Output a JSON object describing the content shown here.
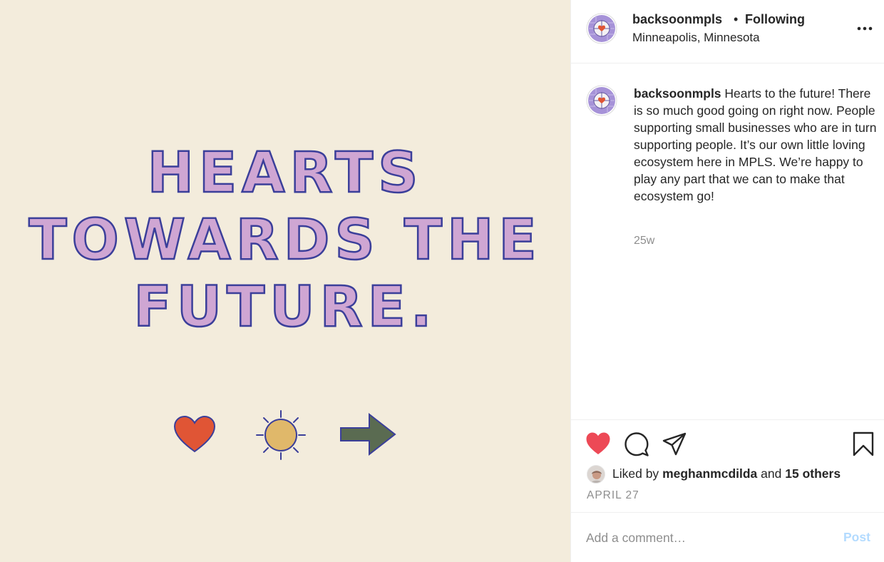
{
  "image": {
    "background_color": "#f3ecdc",
    "headline_lines": [
      "HEARTS",
      "TOWARDS THE",
      "FUTURE."
    ],
    "headline_fill": "#cfa6d3",
    "headline_outline": "#3b3f9a",
    "icons": [
      "heart-icon",
      "sun-icon",
      "arrow-right-icon"
    ]
  },
  "header": {
    "username": "backsoonmpls",
    "separator": "•",
    "follow_status": "Following",
    "location": "Minneapolis, Minnesota",
    "more_icon": "ellipsis-icon"
  },
  "caption": {
    "username": "backsoonmpls",
    "text": "Hearts to the future! There is so much good going on right now. People supporting small businesses who are in turn supporting people. It’s our own little loving ecosystem here in MPLS. We’re happy to play any part that we can to make that ecosystem go!",
    "time": "25w"
  },
  "actions": {
    "liked": true,
    "like_color": "#ed4956",
    "icons": [
      "heart-filled-icon",
      "comment-icon",
      "share-icon",
      "bookmark-icon"
    ]
  },
  "likes": {
    "prefix": "Liked by",
    "user": "meghanmcdilda",
    "connector": "and",
    "others": "15 others"
  },
  "date": "APRIL 27",
  "comment": {
    "placeholder": "Add a comment…",
    "post_label": "Post",
    "post_color": "#b3dbff"
  }
}
